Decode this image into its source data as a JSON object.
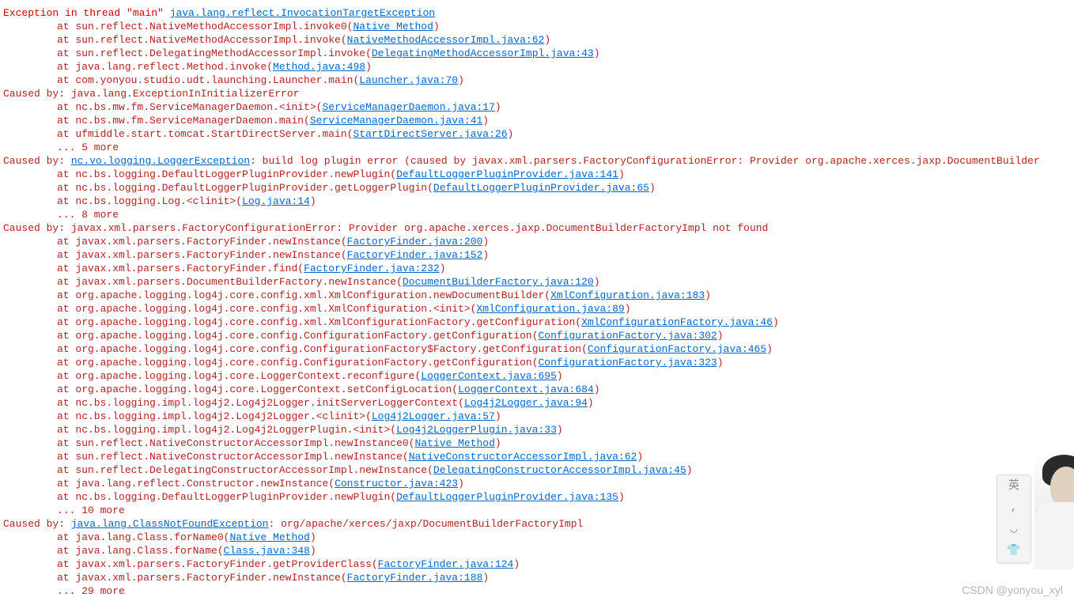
{
  "watermark": "CSDN @yonyou_xyl",
  "ime": [
    "英",
    ",",
    "◡",
    "👕"
  ],
  "lines": [
    {
      "cls": "",
      "segs": [
        {
          "t": "Exception in thread \"main\" ",
          "c": "redbold"
        },
        {
          "t": "java.lang.reflect.InvocationTargetException",
          "c": "link"
        }
      ]
    },
    {
      "cls": "indent1",
      "segs": [
        {
          "t": "at sun.reflect.NativeMethodAccessorImpl.invoke0(",
          "c": "red"
        },
        {
          "t": "Native Method",
          "c": "link"
        },
        {
          "t": ")",
          "c": "red"
        }
      ]
    },
    {
      "cls": "indent1",
      "segs": [
        {
          "t": "at sun.reflect.NativeMethodAccessorImpl.invoke(",
          "c": "red"
        },
        {
          "t": "NativeMethodAccessorImpl.java:62",
          "c": "link"
        },
        {
          "t": ")",
          "c": "red"
        }
      ]
    },
    {
      "cls": "indent1",
      "segs": [
        {
          "t": "at sun.reflect.DelegatingMethodAccessorImpl.invoke(",
          "c": "red"
        },
        {
          "t": "DelegatingMethodAccessorImpl.java:43",
          "c": "link"
        },
        {
          "t": ")",
          "c": "red"
        }
      ]
    },
    {
      "cls": "indent1",
      "segs": [
        {
          "t": "at java.lang.reflect.Method.invoke(",
          "c": "red"
        },
        {
          "t": "Method.java:498",
          "c": "link"
        },
        {
          "t": ")",
          "c": "red"
        }
      ]
    },
    {
      "cls": "indent1",
      "segs": [
        {
          "t": "at com.yonyou.studio.udt.launching.Launcher.main(",
          "c": "red"
        },
        {
          "t": "Launcher.java:70",
          "c": "link"
        },
        {
          "t": ")",
          "c": "red"
        }
      ]
    },
    {
      "cls": "",
      "segs": [
        {
          "t": "Caused by: java.lang.ExceptionInInitializerError",
          "c": "red"
        }
      ]
    },
    {
      "cls": "indent1",
      "segs": [
        {
          "t": "at nc.bs.mw.fm.ServiceManagerDaemon.<init>(",
          "c": "red"
        },
        {
          "t": "ServiceManagerDaemon.java:17",
          "c": "link"
        },
        {
          "t": ")",
          "c": "red"
        }
      ]
    },
    {
      "cls": "indent1",
      "segs": [
        {
          "t": "at nc.bs.mw.fm.ServiceManagerDaemon.main(",
          "c": "red"
        },
        {
          "t": "ServiceManagerDaemon.java:41",
          "c": "link"
        },
        {
          "t": ")",
          "c": "red"
        }
      ]
    },
    {
      "cls": "indent1",
      "segs": [
        {
          "t": "at ufmiddle.start.tomcat.StartDirectServer.main(",
          "c": "red"
        },
        {
          "t": "StartDirectServer.java:26",
          "c": "link"
        },
        {
          "t": ")",
          "c": "red"
        }
      ]
    },
    {
      "cls": "indent1",
      "segs": [
        {
          "t": "... 5 more",
          "c": "red"
        }
      ]
    },
    {
      "cls": "",
      "segs": [
        {
          "t": "Caused by: ",
          "c": "red"
        },
        {
          "t": "nc.vo.logging.LoggerException",
          "c": "link"
        },
        {
          "t": ": build log plugin error (caused by  javax.xml.parsers.FactoryConfigurationError: Provider org.apache.xerces.jaxp.DocumentBuilder",
          "c": "red"
        }
      ]
    },
    {
      "cls": "indent1",
      "segs": [
        {
          "t": "at nc.bs.logging.DefaultLoggerPluginProvider.newPlugin(",
          "c": "red"
        },
        {
          "t": "DefaultLoggerPluginProvider.java:141",
          "c": "link"
        },
        {
          "t": ")",
          "c": "red"
        }
      ]
    },
    {
      "cls": "indent1",
      "segs": [
        {
          "t": "at nc.bs.logging.DefaultLoggerPluginProvider.getLoggerPlugin(",
          "c": "red"
        },
        {
          "t": "DefaultLoggerPluginProvider.java:65",
          "c": "link"
        },
        {
          "t": ")",
          "c": "red"
        }
      ]
    },
    {
      "cls": "indent1",
      "segs": [
        {
          "t": "at nc.bs.logging.Log.<clinit>(",
          "c": "red"
        },
        {
          "t": "Log.java:14",
          "c": "link"
        },
        {
          "t": ")",
          "c": "red"
        }
      ]
    },
    {
      "cls": "indent1",
      "segs": [
        {
          "t": "... 8 more",
          "c": "red"
        }
      ]
    },
    {
      "cls": "",
      "segs": [
        {
          "t": "Caused by: javax.xml.parsers.FactoryConfigurationError: Provider org.apache.xerces.jaxp.DocumentBuilderFactoryImpl not found",
          "c": "red"
        }
      ]
    },
    {
      "cls": "indent1",
      "segs": [
        {
          "t": "at javax.xml.parsers.FactoryFinder.newInstance(",
          "c": "red"
        },
        {
          "t": "FactoryFinder.java:200",
          "c": "link"
        },
        {
          "t": ")",
          "c": "red"
        }
      ]
    },
    {
      "cls": "indent1",
      "segs": [
        {
          "t": "at javax.xml.parsers.FactoryFinder.newInstance(",
          "c": "red"
        },
        {
          "t": "FactoryFinder.java:152",
          "c": "link"
        },
        {
          "t": ")",
          "c": "red"
        }
      ]
    },
    {
      "cls": "indent1",
      "segs": [
        {
          "t": "at javax.xml.parsers.FactoryFinder.find(",
          "c": "red"
        },
        {
          "t": "FactoryFinder.java:232",
          "c": "link"
        },
        {
          "t": ")",
          "c": "red"
        }
      ]
    },
    {
      "cls": "indent1",
      "segs": [
        {
          "t": "at javax.xml.parsers.DocumentBuilderFactory.newInstance(",
          "c": "red"
        },
        {
          "t": "DocumentBuilderFactory.java:120",
          "c": "link"
        },
        {
          "t": ")",
          "c": "red"
        }
      ]
    },
    {
      "cls": "indent1",
      "segs": [
        {
          "t": "at org.apache.logging.log4j.core.config.xml.XmlConfiguration.newDocumentBuilder(",
          "c": "red"
        },
        {
          "t": "XmlConfiguration.java:183",
          "c": "link"
        },
        {
          "t": ")",
          "c": "red"
        }
      ]
    },
    {
      "cls": "indent1",
      "segs": [
        {
          "t": "at org.apache.logging.log4j.core.config.xml.XmlConfiguration.<init>(",
          "c": "red"
        },
        {
          "t": "XmlConfiguration.java:89",
          "c": "link"
        },
        {
          "t": ")",
          "c": "red"
        }
      ]
    },
    {
      "cls": "indent1",
      "segs": [
        {
          "t": "at org.apache.logging.log4j.core.config.xml.XmlConfigurationFactory.getConfiguration(",
          "c": "red"
        },
        {
          "t": "XmlConfigurationFactory.java:46",
          "c": "link"
        },
        {
          "t": ")",
          "c": "red"
        }
      ]
    },
    {
      "cls": "indent1",
      "segs": [
        {
          "t": "at org.apache.logging.log4j.core.config.ConfigurationFactory.getConfiguration(",
          "c": "red"
        },
        {
          "t": "ConfigurationFactory.java:302",
          "c": "link"
        },
        {
          "t": ")",
          "c": "red"
        }
      ]
    },
    {
      "cls": "indent1",
      "segs": [
        {
          "t": "at org.apache.logging.log4j.core.config.ConfigurationFactory$Factory.getConfiguration(",
          "c": "red"
        },
        {
          "t": "ConfigurationFactory.java:465",
          "c": "link"
        },
        {
          "t": ")",
          "c": "red"
        }
      ]
    },
    {
      "cls": "indent1",
      "segs": [
        {
          "t": "at org.apache.logging.log4j.core.config.ConfigurationFactory.getConfiguration(",
          "c": "red"
        },
        {
          "t": "ConfigurationFactory.java:323",
          "c": "link"
        },
        {
          "t": ")",
          "c": "red"
        }
      ]
    },
    {
      "cls": "indent1",
      "segs": [
        {
          "t": "at org.apache.logging.log4j.core.LoggerContext.reconfigure(",
          "c": "red"
        },
        {
          "t": "LoggerContext.java:695",
          "c": "link"
        },
        {
          "t": ")",
          "c": "red"
        }
      ]
    },
    {
      "cls": "indent1",
      "segs": [
        {
          "t": "at org.apache.logging.log4j.core.LoggerContext.setConfigLocation(",
          "c": "red"
        },
        {
          "t": "LoggerContext.java:684",
          "c": "link"
        },
        {
          "t": ")",
          "c": "red"
        }
      ]
    },
    {
      "cls": "indent1",
      "segs": [
        {
          "t": "at nc.bs.logging.impl.log4j2.Log4j2Logger.initServerLoggerContext(",
          "c": "red"
        },
        {
          "t": "Log4j2Logger.java:94",
          "c": "link"
        },
        {
          "t": ")",
          "c": "red"
        }
      ]
    },
    {
      "cls": "indent1",
      "segs": [
        {
          "t": "at nc.bs.logging.impl.log4j2.Log4j2Logger.<clinit>(",
          "c": "red"
        },
        {
          "t": "Log4j2Logger.java:57",
          "c": "link"
        },
        {
          "t": ")",
          "c": "red"
        }
      ]
    },
    {
      "cls": "indent1",
      "segs": [
        {
          "t": "at nc.bs.logging.impl.log4j2.Log4j2LoggerPlugin.<init>(",
          "c": "red"
        },
        {
          "t": "Log4j2LoggerPlugin.java:33",
          "c": "link"
        },
        {
          "t": ")",
          "c": "red"
        }
      ]
    },
    {
      "cls": "indent1",
      "segs": [
        {
          "t": "at sun.reflect.NativeConstructorAccessorImpl.newInstance0(",
          "c": "red"
        },
        {
          "t": "Native Method",
          "c": "link"
        },
        {
          "t": ")",
          "c": "red"
        }
      ]
    },
    {
      "cls": "indent1",
      "segs": [
        {
          "t": "at sun.reflect.NativeConstructorAccessorImpl.newInstance(",
          "c": "red"
        },
        {
          "t": "NativeConstructorAccessorImpl.java:62",
          "c": "link"
        },
        {
          "t": ")",
          "c": "red"
        }
      ]
    },
    {
      "cls": "indent1",
      "segs": [
        {
          "t": "at sun.reflect.DelegatingConstructorAccessorImpl.newInstance(",
          "c": "red"
        },
        {
          "t": "DelegatingConstructorAccessorImpl.java:45",
          "c": "link"
        },
        {
          "t": ")",
          "c": "red"
        }
      ]
    },
    {
      "cls": "indent1",
      "segs": [
        {
          "t": "at java.lang.reflect.Constructor.newInstance(",
          "c": "red"
        },
        {
          "t": "Constructor.java:423",
          "c": "link"
        },
        {
          "t": ")",
          "c": "red"
        }
      ]
    },
    {
      "cls": "indent1",
      "segs": [
        {
          "t": "at nc.bs.logging.DefaultLoggerPluginProvider.newPlugin(",
          "c": "red"
        },
        {
          "t": "DefaultLoggerPluginProvider.java:135",
          "c": "link"
        },
        {
          "t": ")",
          "c": "red"
        }
      ]
    },
    {
      "cls": "indent1",
      "segs": [
        {
          "t": "... 10 more",
          "c": "red"
        }
      ]
    },
    {
      "cls": "",
      "segs": [
        {
          "t": "Caused by: ",
          "c": "red"
        },
        {
          "t": "java.lang.ClassNotFoundException",
          "c": "link"
        },
        {
          "t": ": org/apache/xerces/jaxp/DocumentBuilderFactoryImpl",
          "c": "red"
        }
      ]
    },
    {
      "cls": "indent1",
      "segs": [
        {
          "t": "at java.lang.Class.forName0(",
          "c": "red"
        },
        {
          "t": "Native Method",
          "c": "link"
        },
        {
          "t": ")",
          "c": "red"
        }
      ]
    },
    {
      "cls": "indent1",
      "segs": [
        {
          "t": "at java.lang.Class.forName(",
          "c": "red"
        },
        {
          "t": "Class.java:348",
          "c": "link"
        },
        {
          "t": ")",
          "c": "red"
        }
      ]
    },
    {
      "cls": "indent1",
      "segs": [
        {
          "t": "at javax.xml.parsers.FactoryFinder.getProviderClass(",
          "c": "red"
        },
        {
          "t": "FactoryFinder.java:124",
          "c": "link"
        },
        {
          "t": ")",
          "c": "red"
        }
      ]
    },
    {
      "cls": "indent1",
      "segs": [
        {
          "t": "at javax.xml.parsers.FactoryFinder.newInstance(",
          "c": "red"
        },
        {
          "t": "FactoryFinder.java:188",
          "c": "link"
        },
        {
          "t": ")",
          "c": "red"
        }
      ]
    },
    {
      "cls": "indent1",
      "segs": [
        {
          "t": "... 29 more",
          "c": "red"
        }
      ]
    }
  ]
}
